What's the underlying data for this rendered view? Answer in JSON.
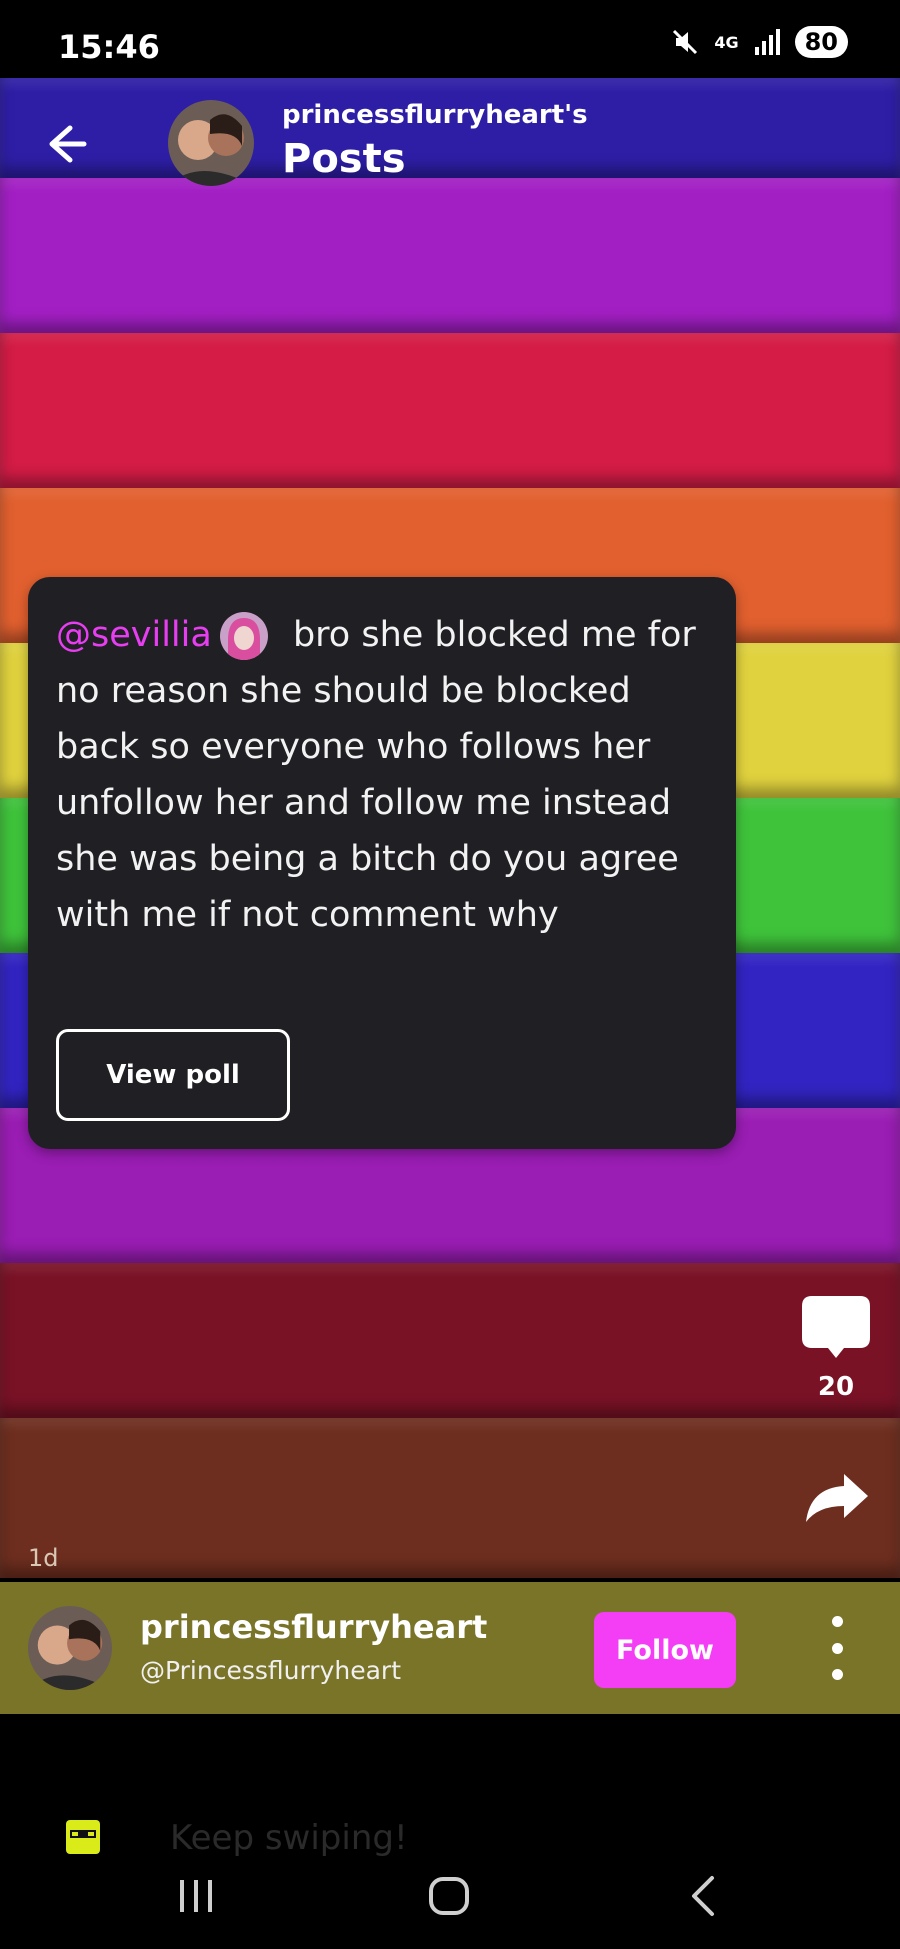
{
  "status_bar": {
    "time": "15:46",
    "network": "4G",
    "battery": "80",
    "icons": [
      "mute-icon",
      "signal-icon",
      "battery-icon"
    ]
  },
  "header": {
    "subtitle": "princessflurryheart's",
    "title": "Posts"
  },
  "post": {
    "mention": "@sevillia",
    "text": " bro she blocked me for no reason she should be blocked back so everyone who follows her unfollow her and follow me instead she was being a bitch do you agree with me if not comment why",
    "view_poll_label": "View poll",
    "comment_count": "20",
    "time_ago": "1d"
  },
  "author": {
    "name": "princessflurryheart",
    "handle": "@Princessflurryheart",
    "follow_label": "Follow"
  },
  "toast": {
    "text": "Keep swiping!"
  },
  "colors": {
    "accent": "#f33ef6",
    "mention": "#e63ef0",
    "card": "#1f1f24",
    "author_bar": "#7a7428"
  }
}
